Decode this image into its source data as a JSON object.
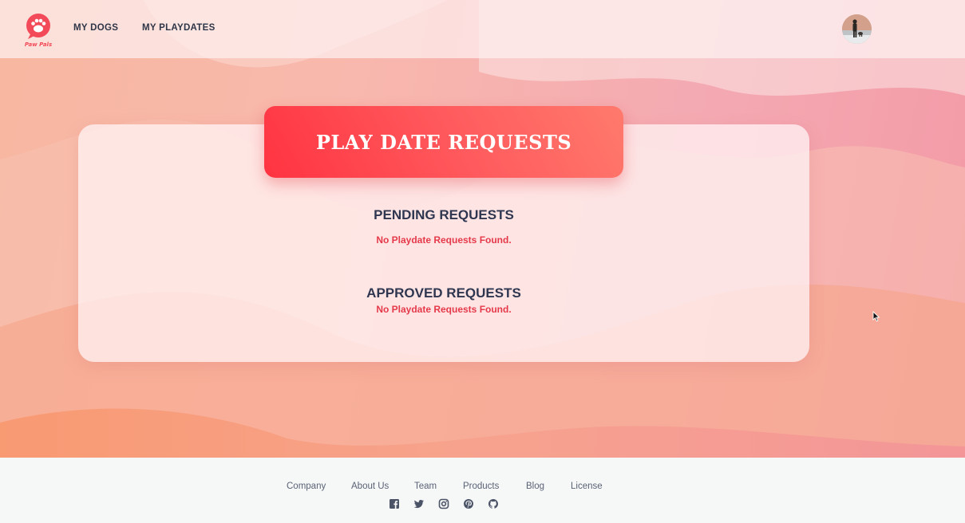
{
  "header": {
    "logo_text": "Paw Pals",
    "nav": [
      {
        "label": "MY DOGS"
      },
      {
        "label": "MY PLAYDATES"
      }
    ]
  },
  "main": {
    "title": "PLAY DATE REQUESTS",
    "pending": {
      "title": "PENDING REQUESTS",
      "empty_message": "No Playdate Requests Found."
    },
    "approved": {
      "title": "APPROVED REQUESTS",
      "empty_message": "No Playdate Requests Found."
    }
  },
  "footer": {
    "links": [
      "Company",
      "About Us",
      "Team",
      "Products",
      "Blog",
      "License"
    ],
    "social_icons": [
      "facebook-icon",
      "twitter-icon",
      "instagram-icon",
      "pinterest-icon",
      "github-icon"
    ]
  },
  "colors": {
    "accent": "#ff3b47",
    "nav_text": "#2e3547",
    "heading_text": "#2f3650",
    "empty_text": "#e5394a",
    "footer_bg": "#f6f7f7"
  }
}
